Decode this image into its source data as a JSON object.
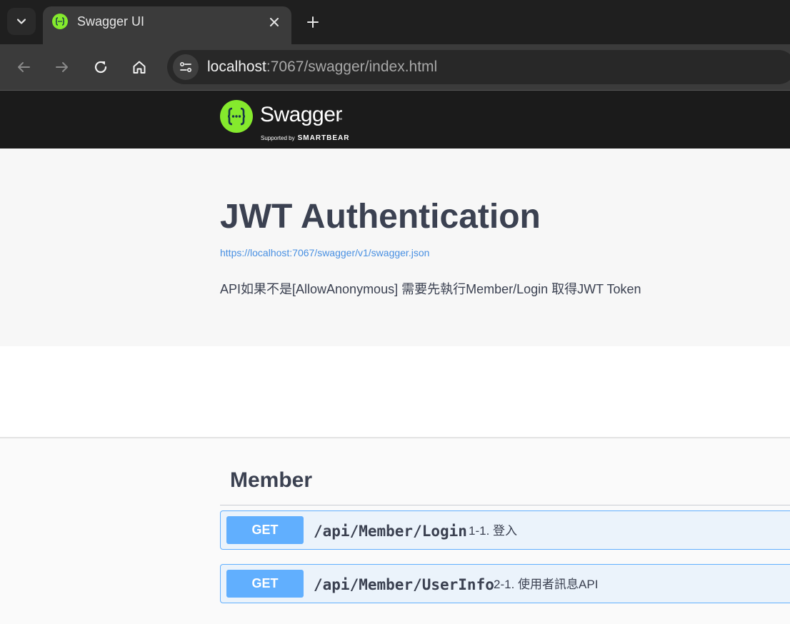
{
  "browser": {
    "tab_title": "Swagger UI",
    "url_host": "localhost",
    "url_rest": ":7067/swagger/index.html"
  },
  "swagger_logo": {
    "name": "Swagger",
    "supported_by": "Supported by",
    "brand": "SMARTBEAR"
  },
  "info": {
    "title": "JWT Authentication",
    "spec_url": "https://localhost:7067/swagger/v1/swagger.json",
    "description": "API如果不是[AllowAnonymous] 需要先執行Member/Login 取得JWT Token"
  },
  "tag": {
    "name": "Member",
    "operations": [
      {
        "method": "GET",
        "path": "/api/Member/Login",
        "summary": "1-1. 登入"
      },
      {
        "method": "GET",
        "path": "/api/Member/UserInfo",
        "summary": "2-1. 使用者訊息API"
      }
    ]
  },
  "colors": {
    "get_accent": "#61affe",
    "swagger_green": "#85ea2d",
    "title_text": "#3b4151",
    "link": "#4990e2"
  },
  "icons": [
    "tab-search-icon",
    "swagger-favicon",
    "close-icon",
    "plus-icon",
    "back-arrow-icon",
    "forward-arrow-icon",
    "reload-icon",
    "home-icon",
    "site-info-icon"
  ]
}
